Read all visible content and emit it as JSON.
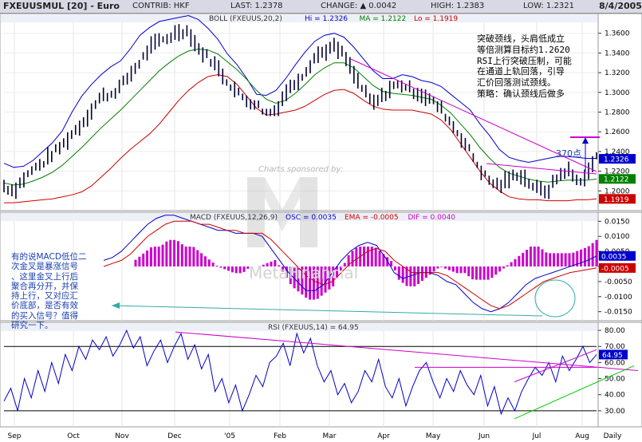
{
  "header": {
    "symbol": "FXEUUSMUL [20] - Euro",
    "contrib": "CONTRIB: HKF",
    "last": "LAST: 1.2378",
    "change": "CHANGE: ▲ 0.0042",
    "high": "HIGH: 1.2383",
    "low": "LOW: 1.2321",
    "date": "8/4/2005"
  },
  "chart_data": [
    {
      "type": "line",
      "title": "BOLL (FXEUUS,20,2)",
      "legend": [
        {
          "label": "Hi = 1.2326",
          "color": "#0000cc"
        },
        {
          "label": "MA = 1.2122",
          "color": "#008000"
        },
        {
          "label": "Lo = 1.1919",
          "color": "#cc0000"
        }
      ],
      "ylim": [
        1.18,
        1.38
      ],
      "y_ticks": [
        "1.3600",
        "1.3400",
        "1.3200",
        "1.3000",
        "1.2800",
        "1.2600",
        "1.2400",
        "1.2200",
        "1.2000"
      ],
      "value_tags": [
        {
          "text": "1.2326",
          "value": 1.2326,
          "color": "#0000cc"
        },
        {
          "text": "1.2122",
          "value": 1.2122,
          "color": "#008000"
        },
        {
          "text": "1.1919",
          "value": 1.1919,
          "color": "#cc0000"
        }
      ],
      "price_keypoints": [
        1.205,
        1.2,
        1.212,
        1.222,
        1.228,
        1.238,
        1.246,
        1.258,
        1.268,
        1.282,
        1.296,
        1.298,
        1.306,
        1.318,
        1.331,
        1.345,
        1.352,
        1.356,
        1.362,
        1.362,
        1.344,
        1.336,
        1.325,
        1.311,
        1.3,
        1.292,
        1.288,
        1.279,
        1.282,
        1.3,
        1.31,
        1.321,
        1.336,
        1.342,
        1.346,
        1.338,
        1.318,
        1.302,
        1.288,
        1.296,
        1.306,
        1.308,
        1.302,
        1.298,
        1.292,
        1.283,
        1.269,
        1.255,
        1.24,
        1.222,
        1.21,
        1.205,
        1.212,
        1.218,
        1.209,
        1.201,
        1.2,
        1.214,
        1.222,
        1.21,
        1.215,
        1.236
      ],
      "series": [
        {
          "name": "Hi",
          "values": [
            1.228,
            1.224,
            1.225,
            1.231,
            1.24,
            1.249,
            1.261,
            1.28,
            1.296,
            1.308,
            1.318,
            1.326,
            1.332,
            1.344,
            1.358,
            1.366,
            1.372,
            1.374,
            1.376,
            1.378,
            1.374,
            1.365,
            1.354,
            1.339,
            1.328,
            1.314,
            1.298,
            1.297,
            1.302,
            1.314,
            1.328,
            1.341,
            1.352,
            1.358,
            1.36,
            1.356,
            1.346,
            1.334,
            1.322,
            1.314,
            1.314,
            1.318,
            1.316,
            1.312,
            1.31,
            1.306,
            1.298,
            1.29,
            1.282,
            1.268,
            1.256,
            1.242,
            1.234,
            1.231,
            1.229,
            1.231,
            1.233,
            1.235,
            1.235,
            1.234,
            1.233,
            1.233
          ]
        },
        {
          "name": "MA",
          "values": [
            1.208,
            1.206,
            1.207,
            1.21,
            1.214,
            1.219,
            1.226,
            1.235,
            1.244,
            1.254,
            1.264,
            1.273,
            1.282,
            1.292,
            1.302,
            1.312,
            1.322,
            1.33,
            1.337,
            1.342,
            1.344,
            1.343,
            1.339,
            1.331,
            1.323,
            1.313,
            1.302,
            1.293,
            1.289,
            1.292,
            1.299,
            1.308,
            1.318,
            1.325,
            1.33,
            1.33,
            1.325,
            1.316,
            1.307,
            1.301,
            1.299,
            1.298,
            1.297,
            1.295,
            1.293,
            1.287,
            1.279,
            1.268,
            1.257,
            1.244,
            1.233,
            1.224,
            1.218,
            1.215,
            1.212,
            1.21,
            1.209,
            1.21,
            1.211,
            1.211,
            1.211,
            1.212
          ]
        },
        {
          "name": "Lo",
          "values": [
            1.188,
            1.188,
            1.189,
            1.19,
            1.191,
            1.192,
            1.194,
            1.196,
            1.199,
            1.205,
            1.214,
            1.223,
            1.233,
            1.242,
            1.25,
            1.258,
            1.268,
            1.28,
            1.292,
            1.302,
            1.31,
            1.316,
            1.318,
            1.316,
            1.308,
            1.296,
            1.284,
            1.277,
            1.278,
            1.28,
            1.282,
            1.286,
            1.292,
            1.298,
            1.302,
            1.303,
            1.299,
            1.292,
            1.286,
            1.283,
            1.282,
            1.282,
            1.282,
            1.28,
            1.278,
            1.272,
            1.262,
            1.248,
            1.234,
            1.22,
            1.208,
            1.2,
            1.194,
            1.192,
            1.191,
            1.191,
            1.19,
            1.19,
            1.19,
            1.191,
            1.191,
            1.192
          ]
        }
      ],
      "annotation_text": "突破颈线，头肩低成立\n等倍测算目标约1.2620\nRSI上行突破压制，可能\n在通道上轨回落，引导\n汇价回落测试颈线。\n策略：确认颈线后做多",
      "points_label": "370点",
      "watermark_top": "Charts sponsored by:"
    },
    {
      "type": "line",
      "title": "MACD (FXEUUS,12,26,9)",
      "legend": [
        {
          "label": "OSC = 0.0035",
          "color": "#0000cc"
        },
        {
          "label": "EMA = -0.0005",
          "color": "#cc0000"
        },
        {
          "label": "DIF = 0.0040",
          "color": "#cc00cc"
        }
      ],
      "ylim": [
        -0.018,
        0.018
      ],
      "y_ticks": [
        "0.0150",
        "0.0100",
        "0.0050",
        "0.0000",
        "-0.0050",
        "-0.0100",
        "-0.0150"
      ],
      "value_tags": [
        {
          "text": "0.0035",
          "value": 0.0035,
          "color": "#0000cc"
        },
        {
          "text": "-0.0005",
          "value": -0.0005,
          "color": "#cc0000"
        }
      ],
      "series": [
        {
          "name": "OSC",
          "values": [
            0.002,
            0.003,
            0.005,
            0.008,
            0.011,
            0.014,
            0.016,
            0.017,
            0.017,
            0.016,
            0.015,
            0.014,
            0.013,
            0.012,
            0.012,
            0.011,
            0.011,
            0.011,
            0.01,
            0.006,
            0.002,
            -0.002,
            -0.005,
            -0.008,
            -0.008,
            -0.006,
            -0.002,
            0.002,
            0.005,
            0.007,
            0.008,
            0.007,
            0.003,
            -0.002,
            -0.004,
            -0.003,
            -0.002,
            -0.002,
            -0.003,
            -0.005,
            -0.006,
            -0.009,
            -0.012,
            -0.014,
            -0.015,
            -0.014,
            -0.012,
            -0.009,
            -0.006,
            -0.004,
            -0.003,
            -0.002,
            -0.001,
            0.0,
            0.001,
            0.002,
            0.0035
          ]
        },
        {
          "name": "EMA",
          "values": [
            0.0,
            0.001,
            0.002,
            0.004,
            0.007,
            0.01,
            0.012,
            0.014,
            0.015,
            0.015,
            0.015,
            0.014,
            0.014,
            0.013,
            0.012,
            0.012,
            0.011,
            0.011,
            0.011,
            0.009,
            0.006,
            0.003,
            0.0,
            -0.003,
            -0.005,
            -0.006,
            -0.005,
            -0.002,
            0.001,
            0.003,
            0.005,
            0.006,
            0.005,
            0.002,
            0.0,
            -0.002,
            -0.002,
            -0.002,
            -0.002,
            -0.003,
            -0.005,
            -0.007,
            -0.009,
            -0.011,
            -0.013,
            -0.014,
            -0.013,
            -0.011,
            -0.009,
            -0.007,
            -0.005,
            -0.004,
            -0.003,
            -0.002,
            -0.0015,
            -0.001,
            -0.0005
          ]
        },
        {
          "name": "DIF",
          "values": [
            0.001,
            0.002,
            0.003,
            0.003,
            0.004,
            0.004,
            0.003,
            0.003,
            0.002,
            0.001,
            0.0,
            -0.0005,
            -0.001,
            -0.001,
            0.0,
            0.0,
            0.0005,
            0.001,
            -0.001,
            -0.003,
            -0.004,
            -0.005,
            -0.005,
            -0.004,
            -0.003,
            -0.0005,
            0.002,
            0.003,
            0.003,
            0.003,
            0.002,
            0.001,
            -0.002,
            -0.003,
            -0.003,
            -0.002,
            -0.001,
            0.0,
            -0.0005,
            -0.001,
            -0.001,
            -0.002,
            -0.002,
            -0.002,
            -0.001,
            0.0,
            0.001,
            0.002,
            0.003,
            0.003,
            0.002,
            0.002,
            0.002,
            0.002,
            0.0025,
            0.003,
            0.004
          ]
        }
      ],
      "annotation_text": "有的说MACD低位二\n次金叉是暴涨信号\n、这里金叉上行后\n聚合再分开，并保\n持上行，又对应汇\n价底部，是否有效\n的买入信号？值得\n研究一下。",
      "watermark_bottom": "MetaFinancial"
    },
    {
      "type": "line",
      "title": "RSI (FXEUUS,14) = 64.95",
      "ylim": [
        20,
        85
      ],
      "y_ticks": [
        "80.00",
        "70.00",
        "60.00",
        "50.00",
        "40.00",
        "30.00"
      ],
      "reference_lines": [
        70,
        30
      ],
      "value_tags": [
        {
          "text": "64.95",
          "value": 64.95,
          "color": "#0000cc"
        }
      ],
      "series": [
        {
          "name": "RSI",
          "values": [
            36,
            44,
            30,
            50,
            38,
            55,
            42,
            60,
            47,
            65,
            55,
            70,
            62,
            74,
            68,
            76,
            64,
            71,
            80,
            69,
            76,
            58,
            67,
            74,
            60,
            70,
            78,
            62,
            71,
            56,
            65,
            42,
            50,
            35,
            46,
            30,
            40,
            52,
            45,
            60,
            64,
            72,
            58,
            78,
            66,
            75,
            58,
            48,
            55,
            40,
            47,
            35,
            42,
            55,
            48,
            62,
            45,
            38,
            50,
            33,
            45,
            55,
            60,
            48,
            38,
            50,
            42,
            55,
            46,
            40,
            52,
            33,
            45,
            28,
            38,
            30,
            42,
            50,
            57,
            52,
            60,
            48,
            64,
            55,
            62,
            70,
            60,
            64.95
          ]
        }
      ]
    }
  ],
  "x_axis": {
    "labels": [
      "Sep",
      "Oct",
      "Nov",
      "Dec",
      "'05",
      "Feb",
      "Mar",
      "Apr",
      "May",
      "Jun",
      "Jul",
      "Aug",
      "Daily"
    ]
  }
}
